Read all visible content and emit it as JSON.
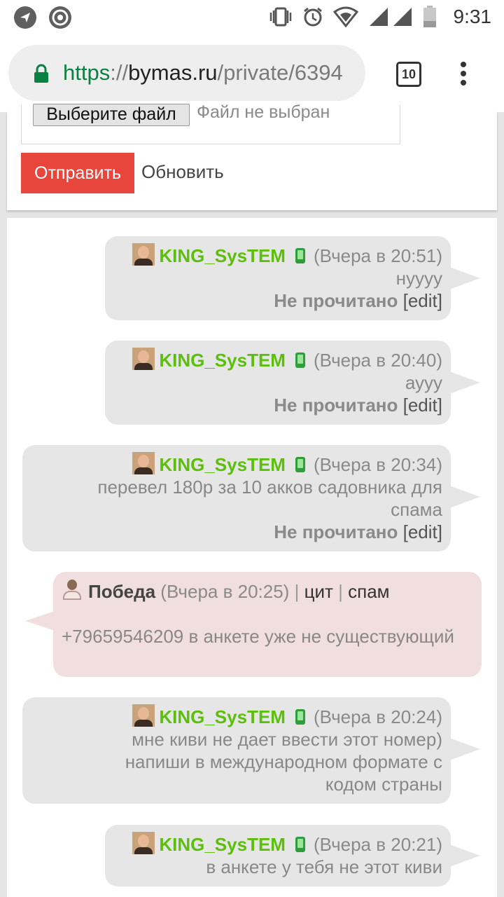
{
  "status_bar": {
    "time": "9:31",
    "left_icons": [
      "send-icon",
      "chrome-icon"
    ],
    "right_icons": [
      "vibrate-icon",
      "alarm-icon",
      "wifi-icon",
      "signal-icon",
      "battery-icon"
    ]
  },
  "browser": {
    "url_scheme": "https",
    "url_separator": "://",
    "url_host": "bymas.ru",
    "url_path": "/private/6394",
    "tab_count": "10"
  },
  "form": {
    "file_button": "Выберите файл",
    "file_status": "Файл не выбран",
    "send_label": "Отправить",
    "refresh_label": "Обновить"
  },
  "colors": {
    "accent": "#e8453c",
    "username": "#5cbf0e",
    "secure": "#0b8043",
    "outgoing_bg": "#e6e6e6",
    "incoming_bg": "#f1dede"
  },
  "messages": [
    {
      "user": "KING_SysTEM",
      "time": "(Вчера в 20:51)",
      "text": "нуууу",
      "status": "Не прочитано",
      "edit": "[edit]"
    },
    {
      "user": "KING_SysTEM",
      "time": "(Вчера в 20:40)",
      "text": "аууу",
      "status": "Не прочитано",
      "edit": "[edit]"
    },
    {
      "user": "KING_SysTEM",
      "time": "(Вчера в 20:34)",
      "text": "перевел 180р за 10 акков садовника для спама",
      "status": "Не прочитано",
      "edit": "[edit]"
    },
    {
      "user": "Победа",
      "time": "(Вчера в 20:25)",
      "sep": "|",
      "quote": "цит",
      "spam": "спам",
      "text": "+79659546209 в анкете уже не существующий"
    },
    {
      "user": "KING_SysTEM",
      "time": "(Вчера в 20:24)",
      "text": "мне киви не дает ввести этот номер) напиши в международном формате с кодом страны"
    },
    {
      "user": "KING_SysTEM",
      "time": "(Вчера в 20:21)",
      "text": "в анкете у тебя не этот киви"
    }
  ]
}
